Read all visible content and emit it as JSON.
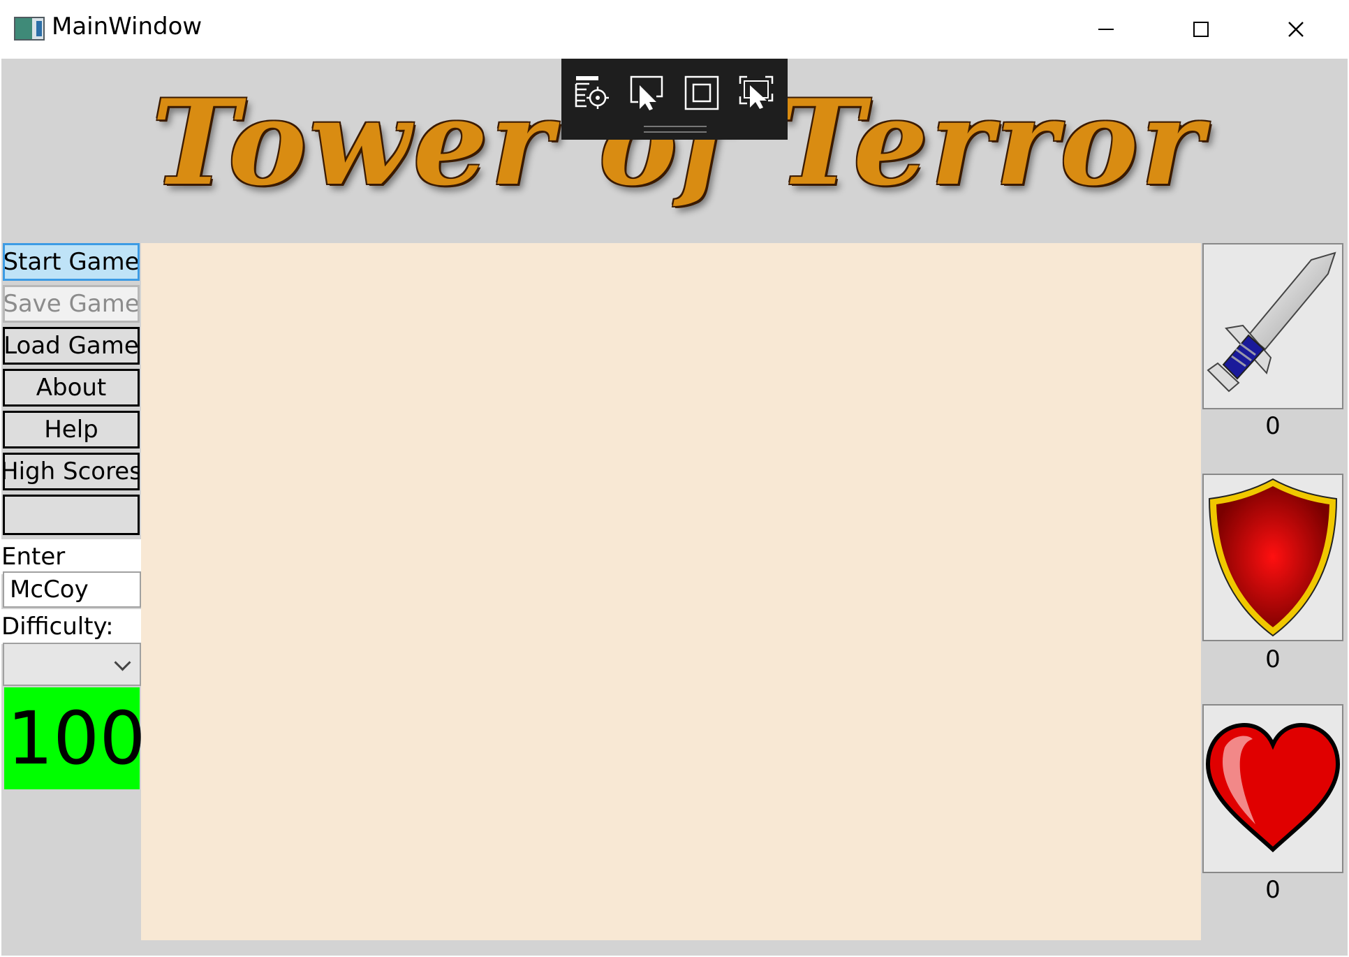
{
  "window": {
    "title": "MainWindow",
    "controls": [
      "minimize-icon",
      "maximize-icon",
      "close-icon"
    ]
  },
  "banner": {
    "title": "Tower of Terror"
  },
  "inspector_toolbar": {
    "tools": [
      "select-element-icon",
      "pointer-icon",
      "layout-adorner-icon",
      "track-focus-icon"
    ]
  },
  "sidebar": {
    "buttons": {
      "start": "Start Game",
      "save": "Save Game",
      "load": "Load Game",
      "about": "About",
      "help": "Help",
      "high_scores": "High Scores",
      "blank": ""
    },
    "name_label": "Enter Name:",
    "name_value": "McCoy",
    "difficulty_label": "Difficulty:",
    "difficulty_value": "",
    "score": "100",
    "score_color": "#00ff00"
  },
  "inventory": {
    "sword": {
      "icon": "sword-icon",
      "count": "0"
    },
    "shield": {
      "icon": "shield-icon",
      "count": "0"
    },
    "heart": {
      "icon": "heart-icon",
      "count": "0"
    }
  },
  "colors": {
    "game_area": "#f8e8d4",
    "background": "#d3d3d3",
    "accent_button": "#bfe3f7"
  }
}
